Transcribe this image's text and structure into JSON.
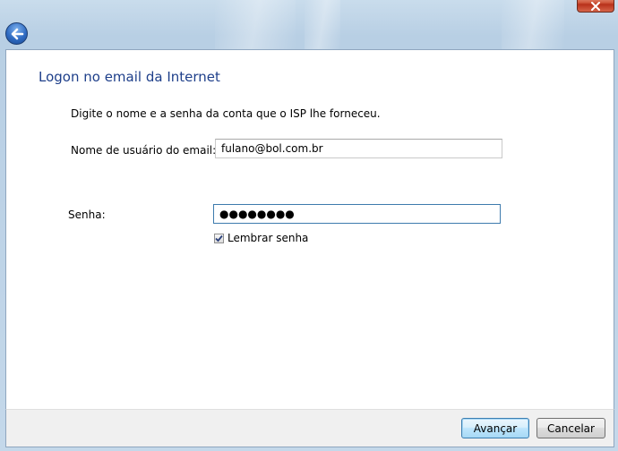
{
  "window": {
    "heading": "Logon no email da Internet",
    "instruction": "Digite o nome e a senha da conta que o ISP lhe forneceu."
  },
  "form": {
    "username_label": "Nome de usuário do email:",
    "username_value": "fulano@bol.com.br",
    "password_label": "Senha:",
    "password_value": "●●●●●●●●",
    "remember_label": "Lembrar senha",
    "remember_checked": true
  },
  "footer": {
    "next_label": "Avançar",
    "cancel_label": "Cancelar"
  },
  "icons": {
    "back": "back-arrow-icon",
    "close": "close-icon",
    "check": "checkmark-icon"
  },
  "colors": {
    "heading": "#1e3f8a",
    "close_button": "#c8442a",
    "back_button": "#2f6bc2",
    "focus_border": "#3d7bad"
  }
}
